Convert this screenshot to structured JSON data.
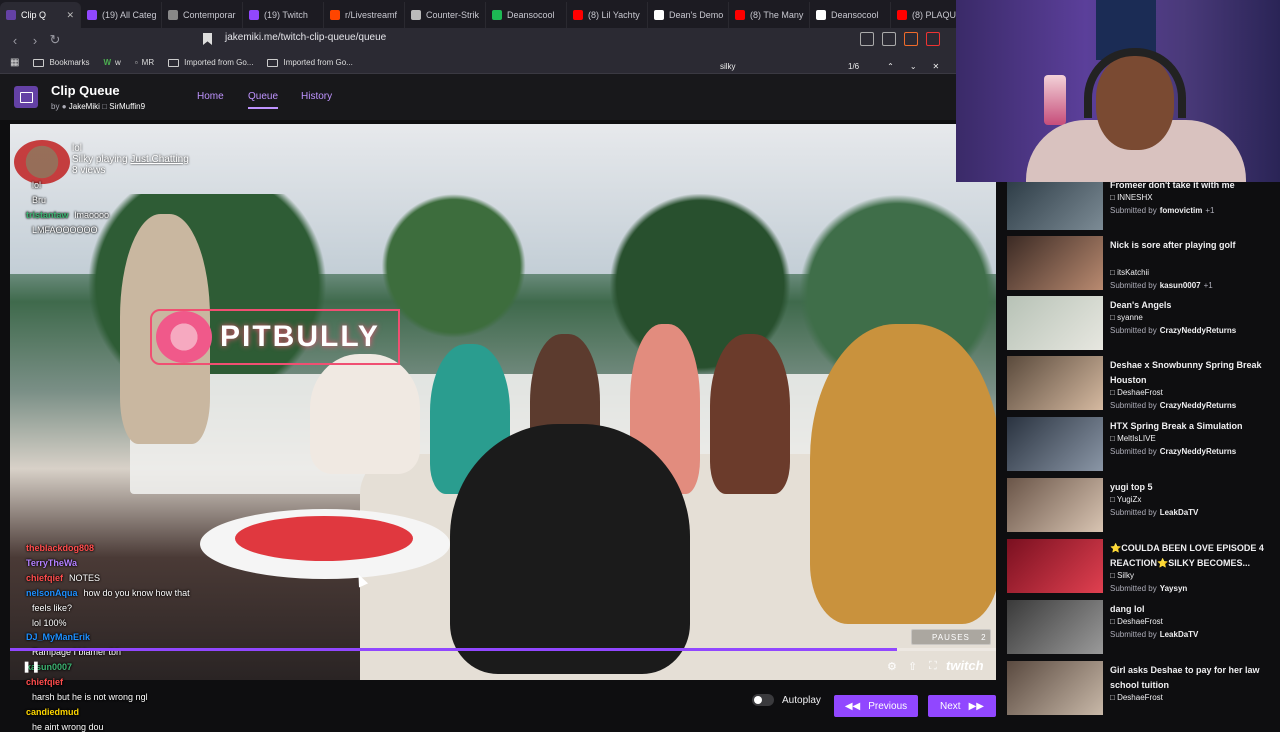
{
  "browser": {
    "tabs": [
      {
        "label": "Clip Q",
        "color": "#6441a5",
        "active": true
      },
      {
        "label": "(19) All Categ",
        "color": "#9147ff"
      },
      {
        "label": "Contemporar",
        "color": "#888888"
      },
      {
        "label": "(19) Twitch",
        "color": "#9147ff"
      },
      {
        "label": "r/Livestreamf",
        "color": "#ff4500"
      },
      {
        "label": "Counter-Strik",
        "color": "#bbbbbb"
      },
      {
        "label": "Deansocool",
        "color": "#1db954"
      },
      {
        "label": "(8) Lil Yachty",
        "color": "#ff0000"
      },
      {
        "label": "Dean's Demo",
        "color": "#ffffff"
      },
      {
        "label": "(8) The Many",
        "color": "#ff0000"
      },
      {
        "label": "Deansocool",
        "color": "#ffffff"
      },
      {
        "label": "(8) PLAQU",
        "color": "#ff0000"
      }
    ],
    "url": "jakemiki.me/twitch-clip-queue/queue",
    "bookmarks": [
      {
        "label": "Bookmarks"
      },
      {
        "label": "w"
      },
      {
        "label": "MR"
      },
      {
        "label": "Imported from Go..."
      },
      {
        "label": "Imported from Go..."
      }
    ],
    "find": {
      "query": "silky",
      "count": "1/6"
    }
  },
  "app": {
    "title": "Clip Queue",
    "by": "by",
    "author": "JakeMiki",
    "author2": "SirMuffin9",
    "nav": {
      "home": "Home",
      "queue": "Queue",
      "history": "History"
    }
  },
  "player": {
    "clip_meta": {
      "first_line": "lol",
      "creator": "Silky",
      "playing": "playing",
      "category": "Just Chatting",
      "views": "8 views"
    },
    "overlay_brand": "PITBULLY",
    "pauses_label": "PAUSES",
    "pauses_count": "2",
    "progress": 0.9,
    "twitch_label": "twitch"
  },
  "chat_top": [
    {
      "name": "",
      "text": "lol",
      "color": "#ff6b6b"
    },
    {
      "name": "",
      "text": "Bru",
      "color": "#3cb371"
    },
    {
      "name": "tristantaw",
      "text": "lmaoooo",
      "color": "#3cb371"
    },
    {
      "name": "",
      "text": "LMFAOOOOOO",
      "color": "#ff4d4d"
    }
  ],
  "chat_bottom": [
    {
      "name": "theblackdog808",
      "text": "",
      "color": "#ff4d4d"
    },
    {
      "name": "TerryTheWa",
      "text": "",
      "color": "#b380ff"
    },
    {
      "name": "chiefqief",
      "text": "NOTES",
      "color": "#ff4d4d"
    },
    {
      "name": "nelsonAqua",
      "text": "how do you know how that",
      "color": "#1e90ff"
    },
    {
      "name": "",
      "text": "feels like?",
      "color": "#1e90ff"
    },
    {
      "name": "",
      "text": "lol 100%",
      "color": "#ff4d4d"
    },
    {
      "name": "DJ_MyManErik",
      "text": "",
      "color": "#1e90ff"
    },
    {
      "name": "",
      "text": "Rampage I blamer tbh",
      "color": "#3cb371"
    },
    {
      "name": "kasun0007",
      "text": "",
      "color": "#3cb371"
    },
    {
      "name": "chiefqief",
      "text": "",
      "color": "#ff4d4d"
    },
    {
      "name": "",
      "text": "harsh but he is not wrong ngl",
      "color": "#b380ff"
    },
    {
      "name": "candiedmud",
      "text": "",
      "color": "#ffd700"
    },
    {
      "name": "",
      "text": "he aint wrong dou",
      "color": "#b380ff"
    }
  ],
  "controls": {
    "autoplay": "Autoplay",
    "previous": "Previous",
    "next": "Next"
  },
  "queue": [
    {
      "title": "Fromeer don't take it with me",
      "channel": "INNESHX",
      "submitted_by": "fomovictim",
      "extra": "+1"
    },
    {
      "title": "Nick is sore after playing golf",
      "channel": "itsKatchii",
      "submitted_by": "kasun0007",
      "extra": "+1"
    },
    {
      "title": "Dean's Angels",
      "channel": "syanne",
      "submitted_by": "CrazyNeddyReturns",
      "extra": ""
    },
    {
      "title": "Deshae x Snowbunny Spring Break Houston",
      "channel": "DeshaeFrost",
      "submitted_by": "CrazyNeddyReturns",
      "extra": ""
    },
    {
      "title": "HTX Spring Break a Simulation",
      "channel": "MeltIsLIVE",
      "submitted_by": "CrazyNeddyReturns",
      "extra": ""
    },
    {
      "title": "yugi top 5",
      "channel": "YugiZx",
      "submitted_by": "LeakDaTV",
      "extra": ""
    },
    {
      "title": "⭐COULDA BEEN LOVE EPISODE 4 REACTION⭐SILKY BECOMES...",
      "channel": "Silky",
      "submitted_by": "Yaysyn",
      "extra": ""
    },
    {
      "title": "dang lol",
      "channel": "DeshaeFrost",
      "submitted_by": "LeakDaTV",
      "extra": ""
    },
    {
      "title": "Girl asks Deshae to pay for her law school tuition",
      "channel": "DeshaeFrost",
      "submitted_by": "",
      "extra": ""
    }
  ],
  "submitted_label": "Submitted by"
}
